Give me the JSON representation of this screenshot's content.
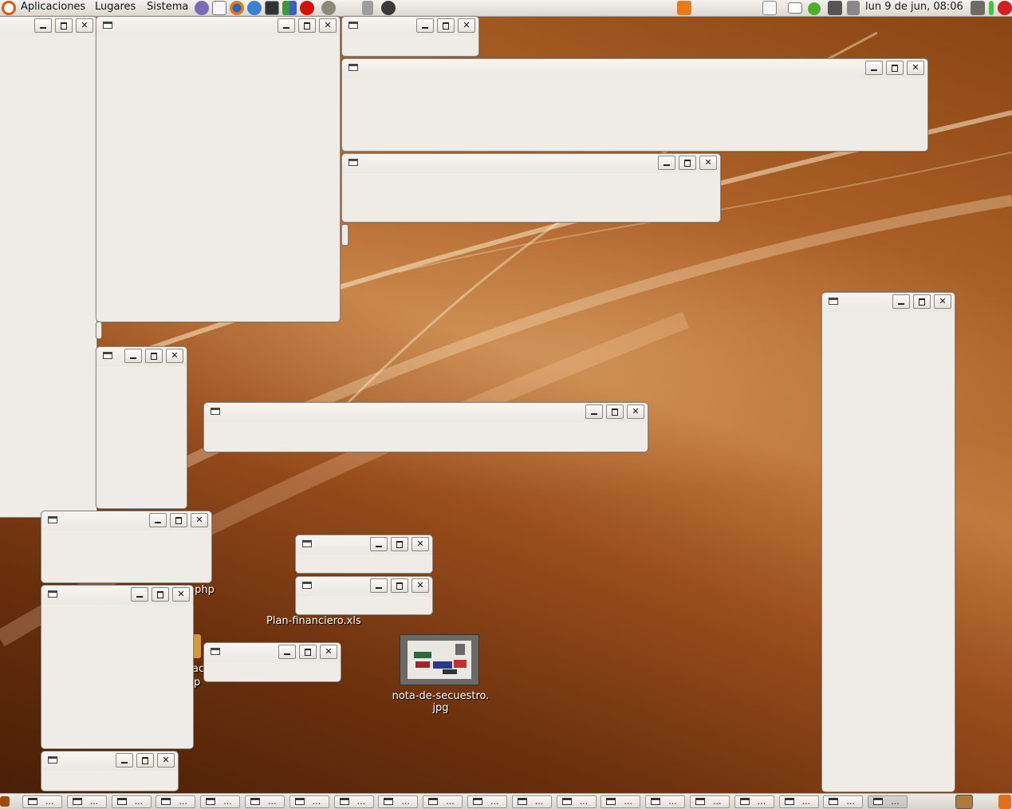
{
  "top_panel": {
    "menus": [
      "Aplicaciones",
      "Lugares",
      "Sistema"
    ],
    "launchers": [
      "app-icon",
      "mail-icon",
      "firefox-icon",
      "browser-icon",
      "terminal-icon",
      "package-icon",
      "lastfm-icon",
      "gimp-icon",
      "trash-icon",
      "update-icon"
    ],
    "clock": "lun  9 de jun, 08:06",
    "tray": [
      "search-icon",
      "notes-icon",
      "mail-tray-icon",
      "network-status-icon",
      "network-icon",
      "volume-icon",
      "battery-icon",
      "power-icon"
    ]
  },
  "desktop_icons": {
    "php_file_label": ".php",
    "xls_label": "Plan-financiero.xls",
    "jpg_label_line1": "nota-de-secuestro.",
    "jpg_label_line2": "jpg",
    "partial_label_a": "ac",
    "partial_label_b": "p"
  },
  "taskbar": {
    "item_label": "...",
    "count": 20
  },
  "colors": {
    "window_bg": "#efebe7",
    "panel_bg": "#dcd8d0",
    "wallpaper": "#8a4513"
  }
}
